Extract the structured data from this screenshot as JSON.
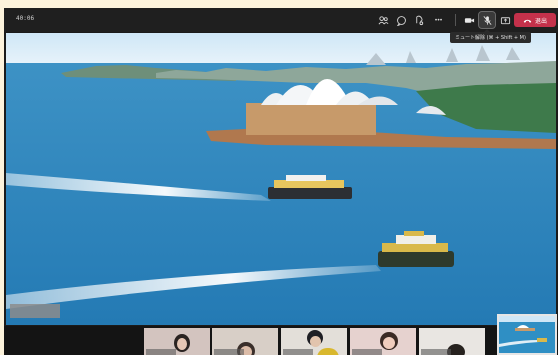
{
  "topbar": {
    "time": "40:06",
    "icons": [
      "people-icon",
      "chat-icon",
      "react-icon",
      "more-icon",
      "camera-icon",
      "mic-off-icon",
      "share-icon"
    ],
    "more_label": "•••",
    "leave_label": "退出"
  },
  "tooltip": {
    "text": "ミュート解除 (⌘ + Shift + M)"
  },
  "colors": {
    "leave": "#c4314b",
    "bar": "#1f1f1f",
    "water": "#2f8fc4"
  },
  "stage": {
    "scene": "shared-video"
  },
  "participants": [
    {
      "name": "participant-1"
    },
    {
      "name": "participant-2"
    },
    {
      "name": "participant-3"
    },
    {
      "name": "participant-4"
    },
    {
      "name": "participant-5"
    }
  ]
}
